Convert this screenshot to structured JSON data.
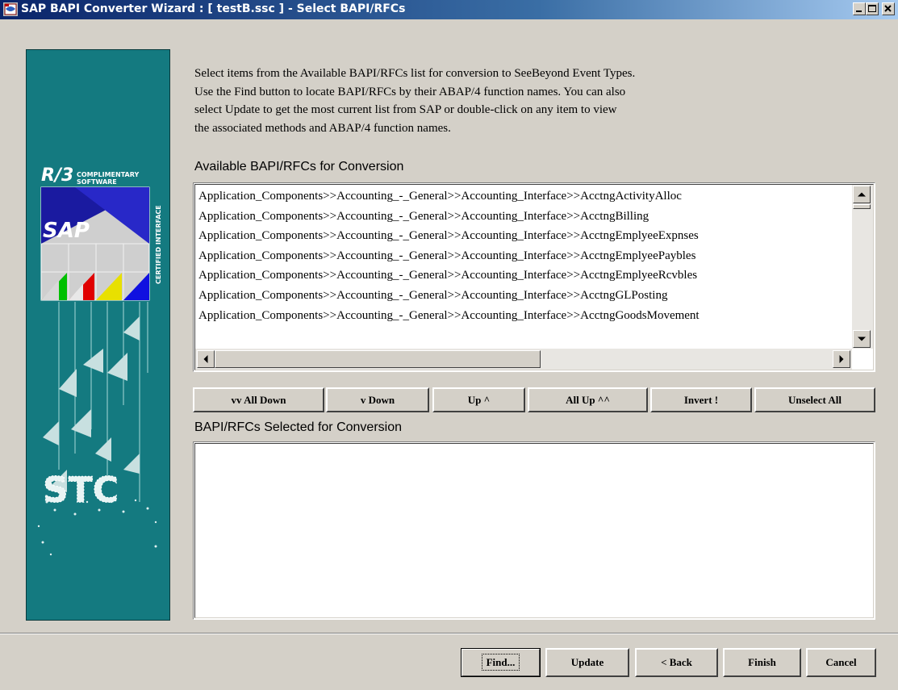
{
  "window": {
    "title": "SAP BAPI Converter Wizard : [ testB.ssc ] - Select BAPI/RFCs"
  },
  "side_banner": {
    "r3_label": "R/3",
    "complimentary": "COMPLIMENTARY",
    "software": "SOFTWARE",
    "sap_label": "SAP",
    "certified_interface": "CERTIFIED INTERFACE",
    "stc_label": "STC"
  },
  "instructions": [
    "Select items from the Available BAPI/RFCs list for conversion to SeeBeyond Event Types.",
    "Use the Find button to locate BAPI/RFCs by their ABAP/4 function names.  You can also",
    "select Update to get the most current list from SAP or double-click on any item to view",
    "the associated methods and ABAP/4 function names."
  ],
  "available": {
    "label": "Available BAPI/RFCs for Conversion",
    "items": [
      "Application_Components>>Accounting_-_General>>Accounting_Interface>>AcctngActivityAlloc",
      "Application_Components>>Accounting_-_General>>Accounting_Interface>>AcctngBilling",
      "Application_Components>>Accounting_-_General>>Accounting_Interface>>AcctngEmplyeeExpnses",
      "Application_Components>>Accounting_-_General>>Accounting_Interface>>AcctngEmplyeePaybles",
      "Application_Components>>Accounting_-_General>>Accounting_Interface>>AcctngEmplyeeRcvbles",
      "Application_Components>>Accounting_-_General>>Accounting_Interface>>AcctngGLPosting",
      "Application_Components>>Accounting_-_General>>Accounting_Interface>>AcctngGoodsMovement"
    ]
  },
  "move_buttons": {
    "all_down": "vv  All Down",
    "down": "v  Down",
    "up": "Up  ^",
    "all_up": "All Up  ^^",
    "invert": "Invert !",
    "unselect_all": "Unselect All"
  },
  "selected": {
    "label": "BAPI/RFCs Selected for Conversion",
    "items": []
  },
  "footer_buttons": {
    "find": "Find...",
    "update": "Update",
    "back": "< Back",
    "finish": "Finish",
    "cancel": "Cancel"
  }
}
